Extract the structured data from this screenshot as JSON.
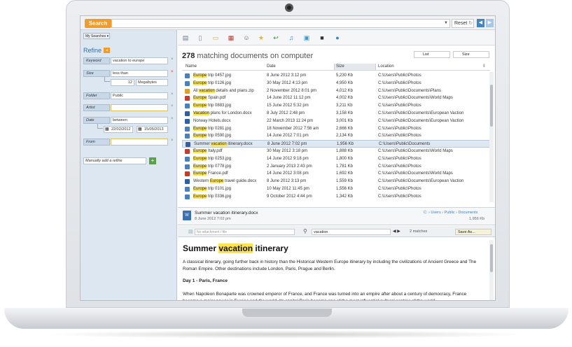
{
  "topbar": {
    "search_label": "Search",
    "reset_label": "Reset"
  },
  "sidebar": {
    "my_searches": "My Searches ▾",
    "refine_title": "Refine",
    "filters": {
      "keyword_label": "Keyword",
      "keyword_value": "vacation to europe",
      "size_label": "Size",
      "size_op": "less than",
      "size_num": "12",
      "size_unit": "Megabytes",
      "folder_label": "Folder",
      "folder_value": "Public",
      "artist_label": "Artist",
      "date_label": "Date",
      "date_op": "between",
      "date_from": "22/02/2012",
      "date_to": "15/05/2013",
      "from_label": "From",
      "add_refine": "Manually add a refine"
    }
  },
  "results": {
    "count": "278",
    "count_suffix": "matching documents on computer",
    "view_mode": "List",
    "sort_by": "Size",
    "columns": {
      "name": "Name",
      "date": "Date",
      "size": "Size",
      "location": "Location"
    },
    "rows": [
      {
        "hl": "Europe",
        "rest": " trip 0457.jpg",
        "date": "8 June 2012  3:12 pm",
        "size": "5,230 Kb",
        "loc": "C:\\Users\\Public\\Photos",
        "icon": "image-icon",
        "color": "#4a7fc0"
      },
      {
        "hl": "Europe",
        "rest": " trip 0126.jpg",
        "date": "30 May 2012  4:13 pm",
        "size": "4,950 Kb",
        "loc": "C:\\Users\\Public\\Photos",
        "icon": "image-icon",
        "color": "#4a7fc0"
      },
      {
        "pre": "All ",
        "hl": "vacation",
        "rest": " details and plans.zip",
        "date": "2 November 2012  8:01 pm",
        "size": "4,012 Kb",
        "loc": "C:\\Users\\Public\\Documents\\Plans",
        "icon": "zip-icon",
        "color": "#e0a020"
      },
      {
        "hl": "Europe",
        "rest": " Spain.pdf",
        "date": "14 June 2012  11:12 pm",
        "size": "4,002 Kb",
        "loc": "C:\\Users\\Public\\Documents\\World Maps",
        "icon": "pdf-icon",
        "color": "#c83a2a"
      },
      {
        "hl": "Europe",
        "rest": " trip 0883.jpg",
        "date": "15 June 2012  5:32 pm",
        "size": "3,211 Kb",
        "loc": "C:\\Users\\Public\\Photos",
        "icon": "image-icon",
        "color": "#4a7fc0"
      },
      {
        "hl": "Vacation",
        "rest": " plans for London.docx",
        "date": "8 July 2012  2:48 pm",
        "size": "3,158 Kb",
        "loc": "C:\\Users\\Public\\Documents\\European Vaction",
        "icon": "word-icon",
        "color": "#2f5fa8"
      },
      {
        "rest": "Norway Hotels.docx",
        "date": "22 March 2013  11:24 pm",
        "size": "3,001 Kb",
        "loc": "C:\\Users\\Public\\Documents\\European Vaction",
        "icon": "word-icon",
        "color": "#2f5fa8"
      },
      {
        "hl": "Europe",
        "rest": " trip 0281.jpg",
        "date": "18 November 2012  7:56 am",
        "size": "2,666 Kb",
        "loc": "C:\\Users\\Public\\Photos",
        "icon": "image-icon",
        "color": "#4a7fc0"
      },
      {
        "hl": "Europe",
        "rest": " trip 0590.jpg",
        "date": "14 June 2012  7:01 pm",
        "size": "2,134 Kb",
        "loc": "C:\\Users\\Public\\Photos",
        "icon": "image-icon",
        "color": "#4a7fc0"
      },
      {
        "pre": "Summer ",
        "hl": "vacation",
        "rest": " itinerary.docx",
        "date": "8 June 2012  7:02 pm",
        "size": "1,956 Kb",
        "loc": "C:\\Users\\Public\\Documents",
        "icon": "word-icon",
        "color": "#2f5fa8",
        "selected": true
      },
      {
        "hl": "Europe",
        "rest": " Italy.pdf",
        "date": "30 May 2012  3:18 pm",
        "size": "1,888 Kb",
        "loc": "C:\\Users\\Public\\Documents\\World Maps",
        "icon": "pdf-icon",
        "color": "#c83a2a"
      },
      {
        "hl": "Europe",
        "rest": " trip 0253.jpg",
        "date": "14 June 2012  9:18 pm",
        "size": "1,800 Kb",
        "loc": "C:\\Users\\Public\\Photos",
        "icon": "image-icon",
        "color": "#4a7fc0"
      },
      {
        "hl": "Europe",
        "rest": " trip 0778.jpg",
        "date": "2 January 2013  2:43 pm",
        "size": "1,781 Kb",
        "loc": "C:\\Users\\Public\\Photos",
        "icon": "image-icon",
        "color": "#4a7fc0"
      },
      {
        "hl": "Europe",
        "rest": " France.pdf",
        "date": "14 June 2012  3:08 pm",
        "size": "1,692 Kb",
        "loc": "C:\\Users\\Public\\Documents\\World Maps",
        "icon": "pdf-icon",
        "color": "#c83a2a"
      },
      {
        "pre": "Western ",
        "hl": "Europe",
        "rest": " travel guide.docx",
        "date": "8 June 2012  3:13 pm",
        "size": "1,559 Kb",
        "loc": "C:\\Users\\Public\\Documents\\European Vaction",
        "icon": "word-icon",
        "color": "#2f5fa8"
      },
      {
        "hl": "Europe",
        "rest": " trip 0101.jpg",
        "date": "10 May 2012  11:45 pm",
        "size": "1,556 Kb",
        "loc": "C:\\Users\\Public\\Photos",
        "icon": "image-icon",
        "color": "#4a7fc0"
      },
      {
        "hl": "Europe",
        "rest": " trip 0336.jpg",
        "date": "9 October 2012  4:44 pm",
        "size": "1,342 Kb",
        "loc": "C:\\Users\\Public\\Photos",
        "icon": "image-icon",
        "color": "#4a7fc0"
      }
    ]
  },
  "preview": {
    "file_name": "Summer vacation itinerary.docx",
    "file_date": "8 June 2012  7:02 pm",
    "crumb": "C: › Users › Public › Documents",
    "file_size": "1,956 Kb",
    "attachments_placeholder": "No attachment / file",
    "find_value": "vacation",
    "match_count": "2 matches",
    "save_as": "Save As..."
  },
  "document": {
    "title_pre": "Summer ",
    "title_hl": "vacation",
    "title_post": " itinerary",
    "para1": "A classical itinerary, going further back in history than the Historical Western Europe itinerary by including the civilizations of Ancient Greece and The Roman Empire. Other destinations include London, Paris, Prague and Berlin.",
    "heading": "Day 1 - Paris, France",
    "para2": "When Napoleon Bonaparte was crowned emperor of France, and France was turned into an empire after about a century of democracy, France became a major power in Europe and the world. Its capital Paris became one of the most influential cultural centres of the world."
  }
}
